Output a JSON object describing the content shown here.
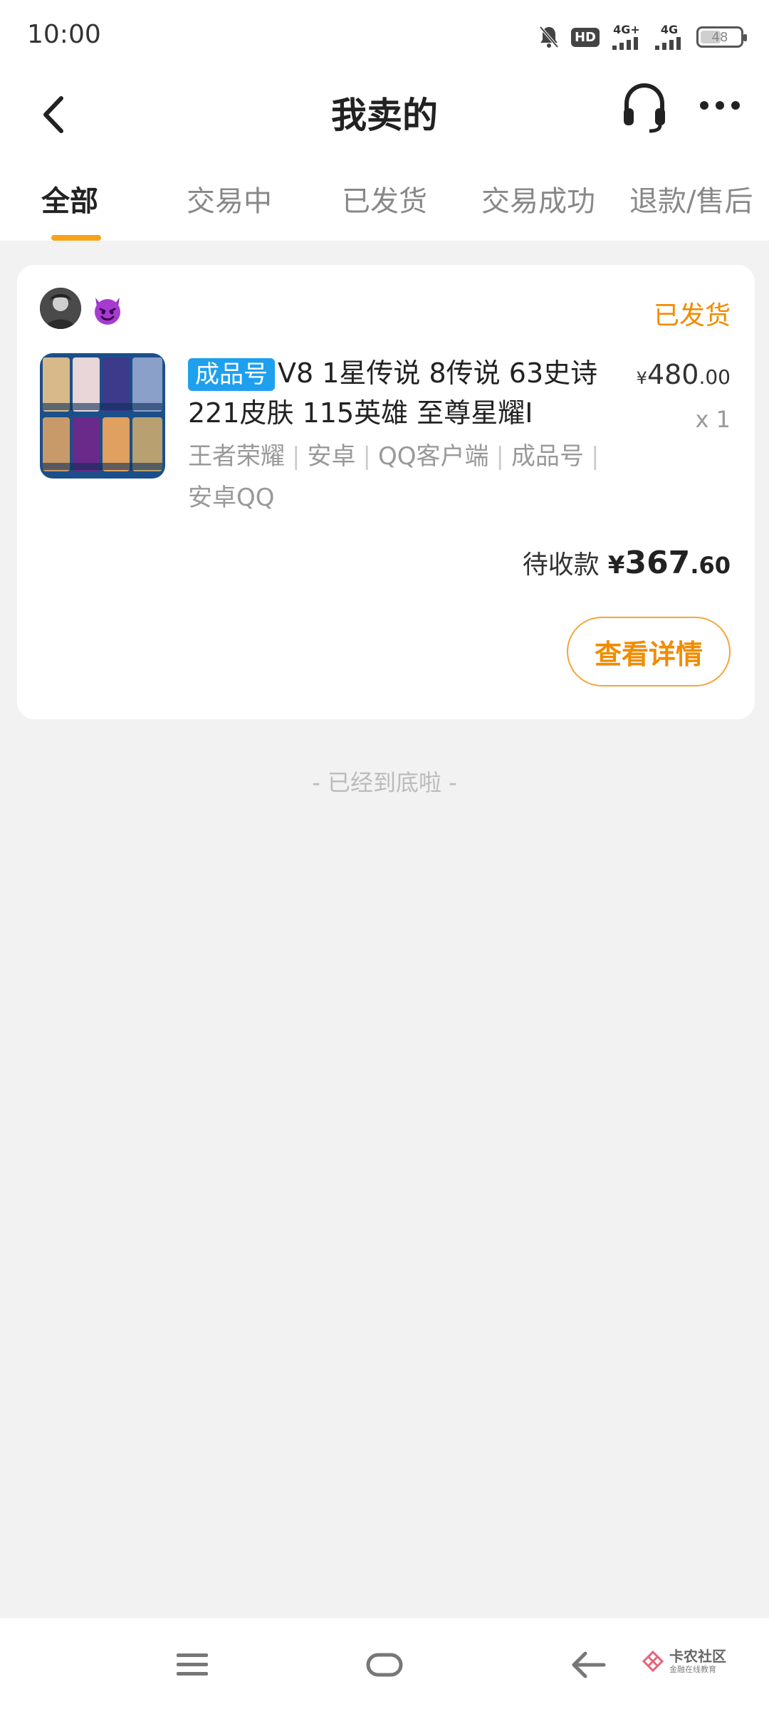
{
  "status_bar": {
    "time": "10:00",
    "icons": [
      "bell-muted-icon",
      "hd-icon",
      "signal-4g-plus-icon",
      "signal-4g-icon",
      "battery-icon"
    ],
    "hd_label": "HD",
    "sim1_label": "4G+",
    "sim2_label": "4G",
    "battery_level": "48"
  },
  "header": {
    "title": "我卖的",
    "back_icon": "chevron-left-icon",
    "service_icon": "headset-icon",
    "more_icon": "more-dots-icon"
  },
  "tabs": [
    {
      "label": "全部",
      "active": true
    },
    {
      "label": "交易中",
      "active": false
    },
    {
      "label": "已发货",
      "active": false
    },
    {
      "label": "交易成功",
      "active": false
    },
    {
      "label": "退款/售后",
      "active": false
    }
  ],
  "colors": {
    "accent": "#f6a31b",
    "status_orange": "#f08c00",
    "tag_blue": "#1ea0ee",
    "background": "#f2f2f2"
  },
  "order": {
    "badge_icon": "devil-emoji-icon",
    "status": "已发货",
    "product": {
      "tag": "成品号",
      "title": "V8 1星传说 8传说 63史诗 221皮肤 115英雄 至尊星耀I",
      "meta": [
        "王者荣耀",
        "安卓",
        "QQ客户端",
        "成品号",
        "安卓QQ"
      ],
      "price_currency": "¥",
      "price_int": "480",
      "price_dec": ".00",
      "quantity": "x 1"
    },
    "receivable_label": "待收款",
    "receivable_currency": "¥",
    "receivable_int": "367",
    "receivable_dec": ".60",
    "detail_button": "查看详情"
  },
  "end_hint": "- 已经到底啦 -",
  "nav_bar": {
    "menu_icon": "menu-icon",
    "home_icon": "home-icon",
    "back_icon": "back-arrow-icon",
    "watermark_main": "卡农社区",
    "watermark_sub": "金融在线教育"
  }
}
